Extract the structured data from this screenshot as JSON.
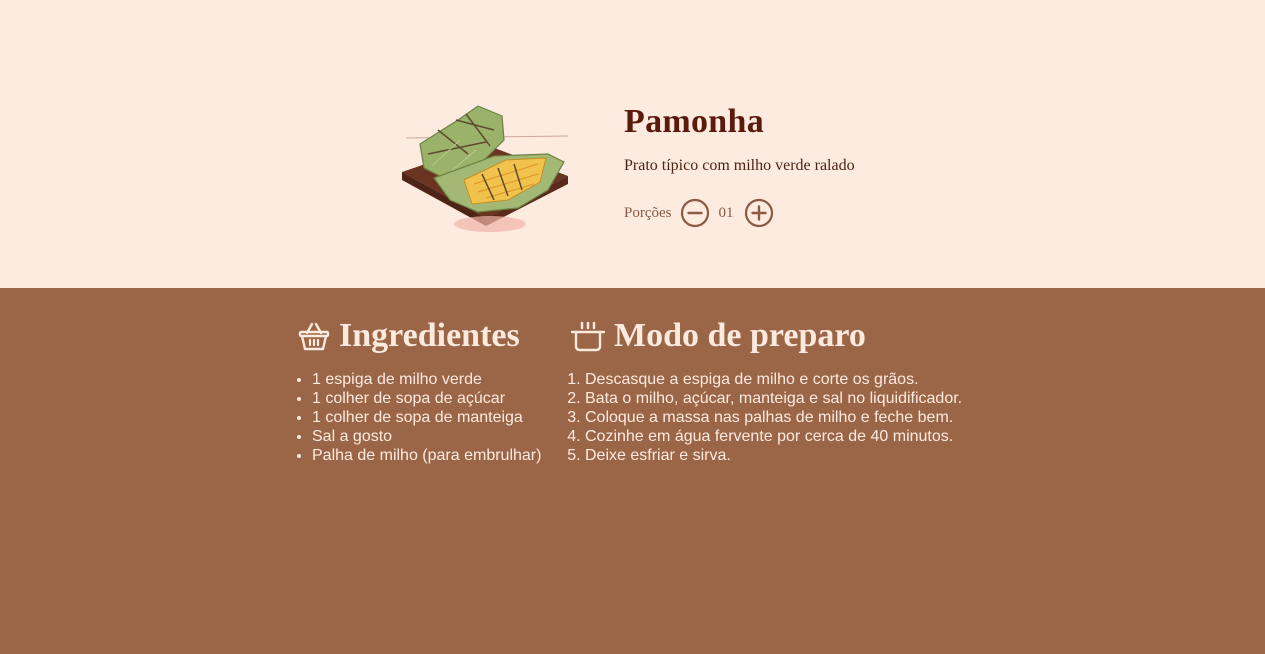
{
  "recipe": {
    "title": "Pamonha",
    "description": "Prato típico com milho verde ralado",
    "image_icon": "pamonha-illustration",
    "servings": {
      "label": "Porções",
      "value": "01",
      "decrement_icon": "minus-circle-icon",
      "increment_icon": "plus-circle-icon"
    }
  },
  "ingredients": {
    "icon": "basket-icon",
    "title": "Ingredientes",
    "items": [
      "1 espiga de milho verde",
      "1 colher de sopa de açúcar",
      "1 colher de sopa de manteiga",
      "Sal a gosto",
      "Palha de milho (para embrulhar)"
    ]
  },
  "method": {
    "icon": "cooking-pot-icon",
    "title": "Modo de preparo",
    "steps": [
      "Descasque a espiga de milho e corte os grãos.",
      "Bata o milho, açúcar, manteiga e sal no liquidificador.",
      "Coloque a massa nas palhas de milho e feche bem.",
      "Cozinhe em água fervente por cerca de 40 minutos.",
      "Deixe esfriar e sirva."
    ]
  },
  "colors": {
    "hero_background": "#feebe0",
    "page_background": "#9b6647",
    "title_color": "#5a1a0c",
    "light_text": "#fdeadf",
    "accent": "#8a5a42"
  }
}
